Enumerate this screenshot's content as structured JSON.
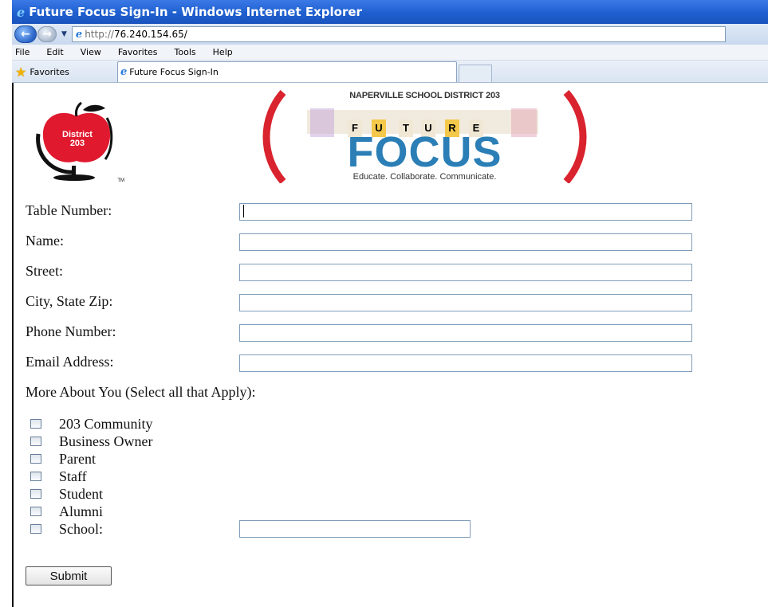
{
  "window": {
    "title": "Future Focus Sign-In - Windows Internet Explorer",
    "url_protocol": "http://",
    "url_host": "76.240.154.65/"
  },
  "menu": [
    "File",
    "Edit",
    "View",
    "Favorites",
    "Tools",
    "Help"
  ],
  "favorites_bar": {
    "favorites_label": "Favorites",
    "tab_title": "Future Focus Sign-In"
  },
  "logos": {
    "district_text_1": "District",
    "district_text_2": "203",
    "district_tm": "TM",
    "ff_top": "NAPERVILLE SCHOOL DISTRICT 203",
    "ff_letters": [
      "F",
      "U",
      "T",
      "U",
      "R",
      "E"
    ],
    "ff_word": "FOCUS",
    "ff_tagline": "Educate. Collaborate. Communicate."
  },
  "form": {
    "fields": [
      {
        "label": "Table Number:",
        "value": ""
      },
      {
        "label": "Name:",
        "value": ""
      },
      {
        "label": "Street:",
        "value": ""
      },
      {
        "label": "City, State Zip:",
        "value": ""
      },
      {
        "label": "Phone Number:",
        "value": ""
      },
      {
        "label": "Email Address:",
        "value": ""
      }
    ],
    "more_about": "More About You (Select all that Apply):",
    "checkboxes": [
      {
        "label": "203 Community",
        "checked": false
      },
      {
        "label": "Business Owner",
        "checked": false
      },
      {
        "label": "Parent",
        "checked": false
      },
      {
        "label": "Staff",
        "checked": false
      },
      {
        "label": "Student",
        "checked": false
      },
      {
        "label": "Alumni",
        "checked": false
      },
      {
        "label": "School:",
        "checked": false
      }
    ],
    "school_value": "",
    "submit_label": "Submit"
  },
  "colors": {
    "title_bar": "#1f5fcf",
    "apple_red": "#e0192e",
    "focus_blue": "#2b7fb6",
    "paren_red": "#d9232e"
  }
}
